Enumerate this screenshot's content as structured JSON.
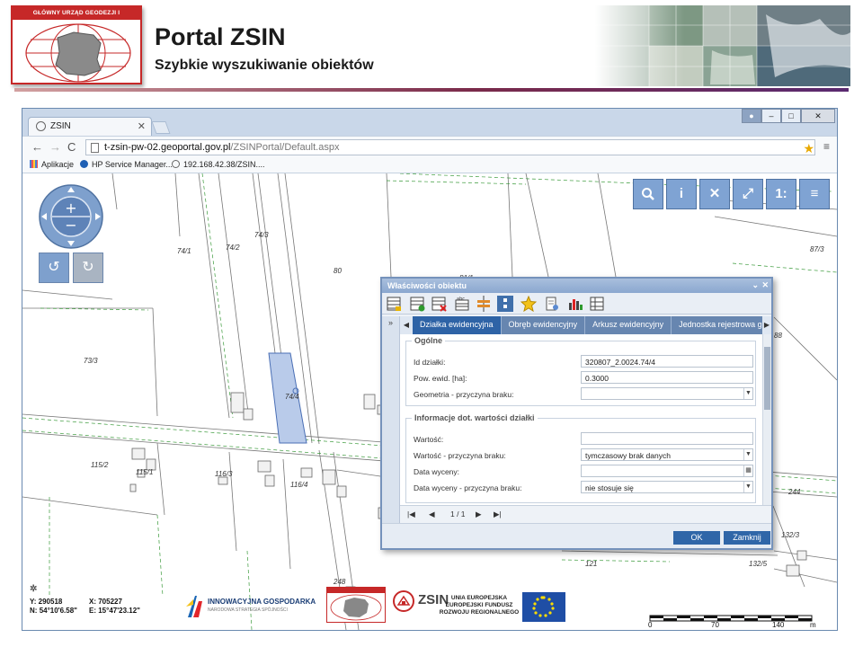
{
  "slide": {
    "logo_text": "GŁÓWNY URZĄD GEODEZJI I KARTOGRAFII",
    "title": "Portal ZSIN",
    "subtitle": "Szybkie wyszukiwanie obiektów"
  },
  "browser": {
    "tab_title": "ZSIN",
    "url_host": "t-zsin-pw-02.geoportal.gov.pl",
    "url_path": "/ZSINPortal/Default.aspx",
    "bookmarks": [
      "Aplikacje",
      "HP Service Manager...",
      "192.168.42.38/ZSIN...."
    ]
  },
  "map": {
    "toolbar_icons": [
      "search-icon",
      "info-icon",
      "full-extent-icon",
      "fullscreen-icon",
      "scale-icon",
      "menu-icon"
    ],
    "scale_button_label": "1:",
    "plot_labels": [
      "74/1",
      "74/2",
      "74/3",
      "80",
      "81/1",
      "87/3",
      "73/3",
      "74/4",
      "115/2",
      "115/1",
      "116/3",
      "116/4",
      "121",
      "132/3",
      "132/5",
      "244",
      "248",
      "88"
    ],
    "coords": {
      "y_label": "Y:",
      "y_value": "290518",
      "n_label": "N:",
      "n_value": "54°10'6.58\"",
      "x_label": "X:",
      "x_value": "705227",
      "e_label": "E:",
      "e_value": "15°47'23.12\""
    },
    "footer_logos": {
      "innovative": "INNOWACYJNA GOSPODARKA",
      "innovative_sub": "NARODOWA STRATEGIA SPÓJNOŚCI",
      "zsin": "ZSIN",
      "eu_line1": "UNIA EUROPEJSKA",
      "eu_line2": "EUROPEJSKI FUNDUSZ",
      "eu_line3": "ROZWOJU REGIONALNEGO"
    },
    "scale_ticks": [
      "0",
      "70",
      "140",
      "m"
    ]
  },
  "dialog": {
    "title": "Właściwości obiektu",
    "tabs": [
      "Działka ewidencyjna",
      "Obręb ewidencyjny",
      "Arkusz ewidencyjny",
      "Jednostka rejestrowa grun"
    ],
    "active_tab": "Działka ewidencyjna",
    "general": {
      "legend": "Ogólne",
      "id_label": "Id działki:",
      "id_value": "320807_2.0024.74/4",
      "area_label": "Pow. ewid. [ha]:",
      "area_value": "0.3000",
      "geometry_label": "Geometria - przyczyna braku:",
      "geometry_value": ""
    },
    "value_info": {
      "legend": "Informacje dot. wartości działki",
      "value_label": "Wartość:",
      "value_value": "",
      "value_reason_label": "Wartość - przyczyna braku:",
      "value_reason_value": "tymczasowy brak danych",
      "valuation_date_label": "Data wyceny:",
      "valuation_date_value": "",
      "valuation_reason_label": "Data wyceny - przyczyna braku:",
      "valuation_reason_value": "nie stosuje się"
    },
    "pager": "1 / 1",
    "ok_label": "OK",
    "close_label": "Zamknij"
  }
}
